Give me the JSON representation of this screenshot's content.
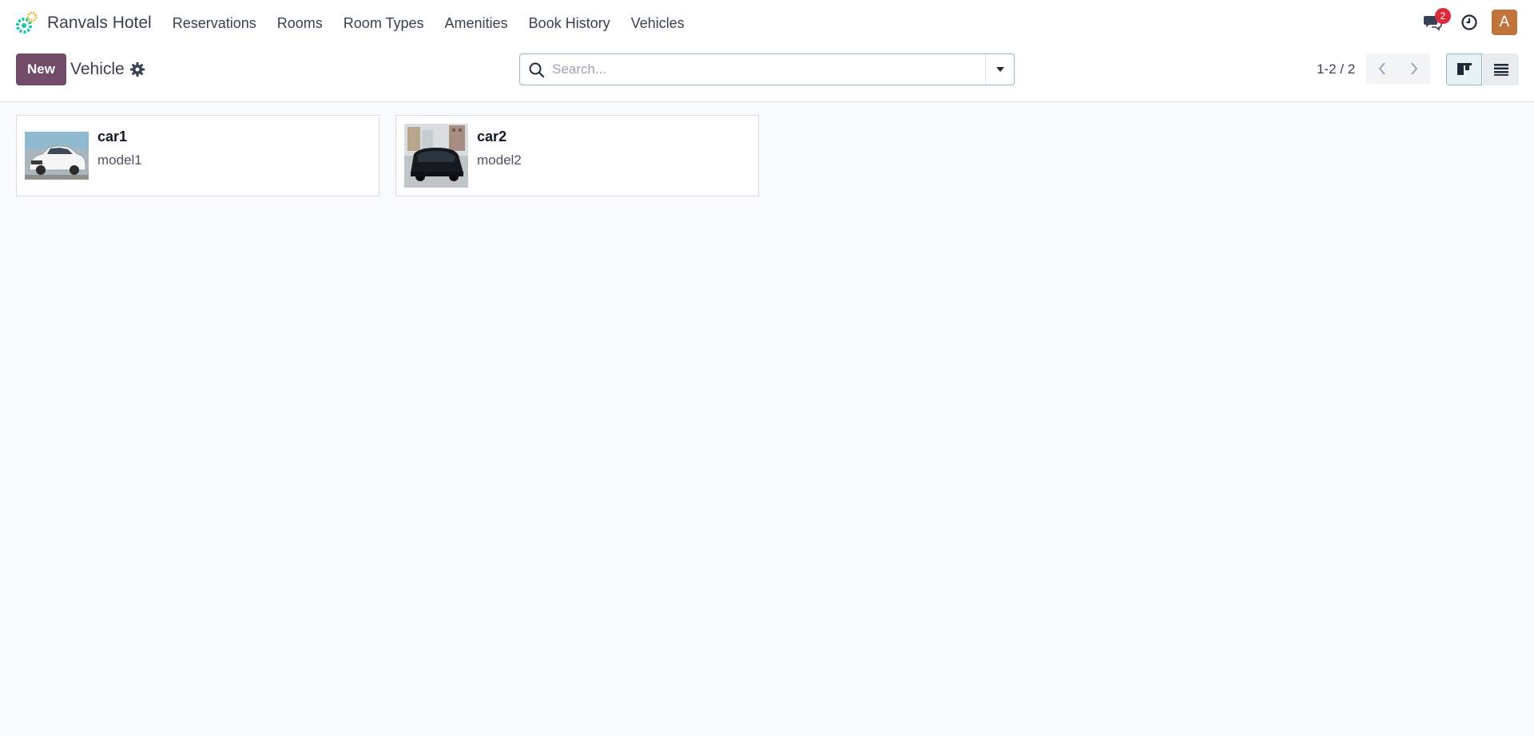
{
  "app": {
    "name": "Ranvals Hotel",
    "menu": [
      "Reservations",
      "Rooms",
      "Room Types",
      "Amenities",
      "Book History",
      "Vehicles"
    ],
    "messages_count": "2",
    "user_initial": "A"
  },
  "control": {
    "new_label": "New",
    "title": "Vehicle",
    "search_placeholder": "Search...",
    "pager": "1-2 / 2"
  },
  "cards": [
    {
      "name": "car1",
      "model": "model1"
    },
    {
      "name": "car2",
      "model": "model2"
    }
  ],
  "colors": {
    "brand": "#714b67",
    "badge": "#dc2a3d",
    "avatar": "#c0743b"
  }
}
